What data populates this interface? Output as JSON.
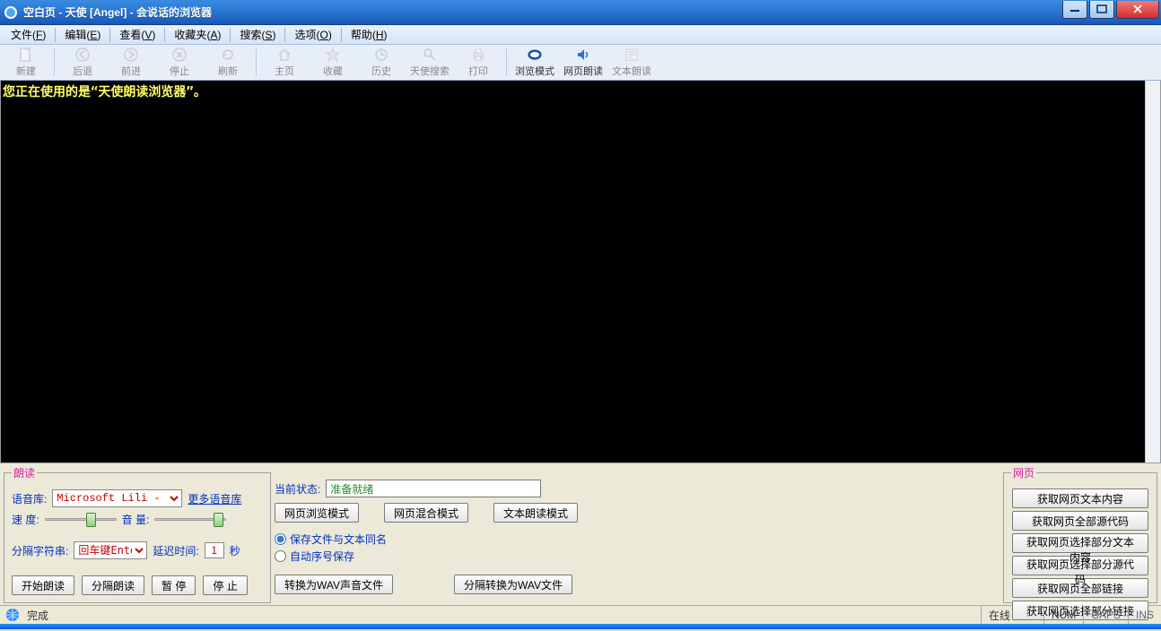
{
  "title": "空白页 - 天使 [Angel] - 会说话的浏览器",
  "menus": {
    "file": {
      "label": "文件",
      "accel": "F"
    },
    "edit": {
      "label": "编辑",
      "accel": "E"
    },
    "view": {
      "label": "查看",
      "accel": "V"
    },
    "fav": {
      "label": "收藏夹",
      "accel": "A"
    },
    "search": {
      "label": "搜索",
      "accel": "S"
    },
    "options": {
      "label": "选项",
      "accel": "O"
    },
    "help": {
      "label": "帮助",
      "accel": "H"
    }
  },
  "toolbar": {
    "new": "新建",
    "back": "后退",
    "fwd": "前进",
    "stop": "停止",
    "refresh": "刷新",
    "home": "主页",
    "fav": "收藏",
    "history": "历史",
    "angelsearch": "天使搜索",
    "print": "打印",
    "browse": "浏览模式",
    "pageread": "网页朗读",
    "textread": "文本朗读"
  },
  "content_message": "您正在使用的是“天使朗读浏览器”。",
  "read_panel": {
    "legend": "朗读",
    "voice_label": "语音库:",
    "voice_value": "Microsoft Lili - Chines",
    "more_voices": "更多语音库",
    "speed_label": "速  度:",
    "volume_label": "音  量:",
    "sep_label": "分隔字符串:",
    "sep_value": "回车键Enter",
    "delay_label": "延迟时间:",
    "delay_value": "1",
    "delay_unit": "秒",
    "btn_start": "开始朗读",
    "btn_split": "分隔朗读",
    "btn_pause": "暂   停",
    "btn_stop": "停   止"
  },
  "mid_panel": {
    "status_label": "当前状态:",
    "status_value": "准备就绪",
    "btn_browse": "网页浏览模式",
    "btn_mixed": "网页混合模式",
    "btn_textread": "文本朗读模式",
    "radio_same": "保存文件与文本同名",
    "radio_auto": "自动序号保存",
    "btn_convert": "转换为WAV声音文件",
    "btn_splitconvert": "分隔转换为WAV文件"
  },
  "web_panel": {
    "legend": "网页",
    "b1": "获取网页文本内容",
    "b2": "获取网页全部源代码",
    "b3": "获取网页选择部分文本内容",
    "b4": "获取网页选择部分源代码",
    "b5": "获取网页全部链接",
    "b6": "获取网页选择部分链接"
  },
  "statusbar": {
    "done": "完成",
    "online": "在线",
    "num": "NUM",
    "caps": "CAPS",
    "ins": "INS"
  }
}
